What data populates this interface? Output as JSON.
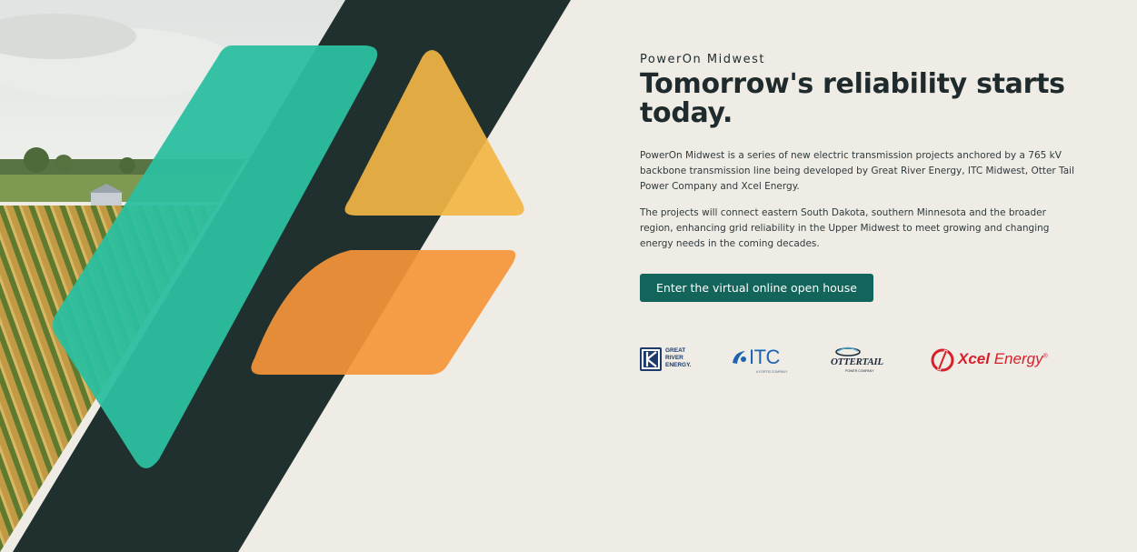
{
  "hero": {
    "eyebrow": "PowerOn Midwest",
    "headline": "Tomorrow's reliability starts today.",
    "paragraph_1": "PowerOn Midwest is a series of new electric transmission projects anchored by a 765 kV backbone transmission line being developed by Great River Energy, ITC Midwest, Otter Tail Power Company and Xcel Energy.",
    "paragraph_2": "The projects will connect eastern South Dakota, southern Minnesota and the broader region, enhancing grid reliability in the Upper Midwest to meet growing and changing energy needs in the coming decades.",
    "cta_label": "Enter the virtual online open house"
  },
  "logos": {
    "great_river": {
      "line1": "GREAT",
      "line2": "RIVER",
      "line3": "ENERGY."
    },
    "itc": {
      "name": "ITC",
      "tagline": "A FORTIS COMPANY"
    },
    "otter_tail": {
      "name": "OTTERTAIL",
      "tagline": "POWER COMPANY"
    },
    "xcel": {
      "name_bold": "Xcel",
      "name_regular": "Energy",
      "mark": "®"
    }
  },
  "colors": {
    "background": "#efece6",
    "dark_slab": "#20302f",
    "teal": "#2bbfa0",
    "yellow": "#f2b544",
    "orange": "#f59538",
    "button": "#13645a",
    "text": "#1f2a2c"
  }
}
